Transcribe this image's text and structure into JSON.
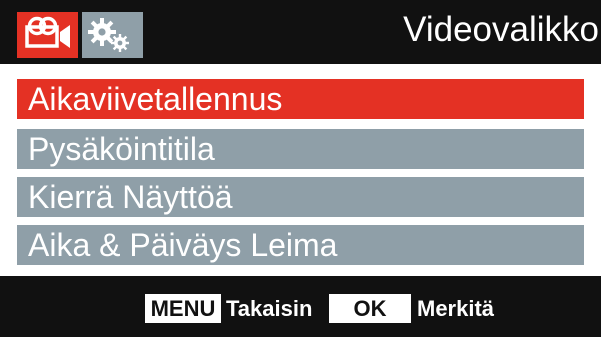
{
  "header": {
    "title": "Videovalikko",
    "tabs": [
      {
        "icon": "video-camera-icon",
        "selected": true
      },
      {
        "icon": "settings-gears-icon",
        "selected": false
      }
    ]
  },
  "menu": {
    "items": [
      {
        "label": "Aikaviivetallennus",
        "selected": true
      },
      {
        "label": "Pysäköintitila",
        "selected": false
      },
      {
        "label": "Kierrä Näyttöä",
        "selected": false
      },
      {
        "label": "Aika & Päiväys Leima",
        "selected": false
      }
    ]
  },
  "footer": {
    "menu_key": "MENU",
    "menu_action": "Takaisin",
    "ok_key": "OK",
    "ok_action": "Merkitä"
  },
  "colors": {
    "accent": "#e43124",
    "inactive": "#8f9fa8",
    "background": "#111111",
    "panel": "#ffffff"
  }
}
